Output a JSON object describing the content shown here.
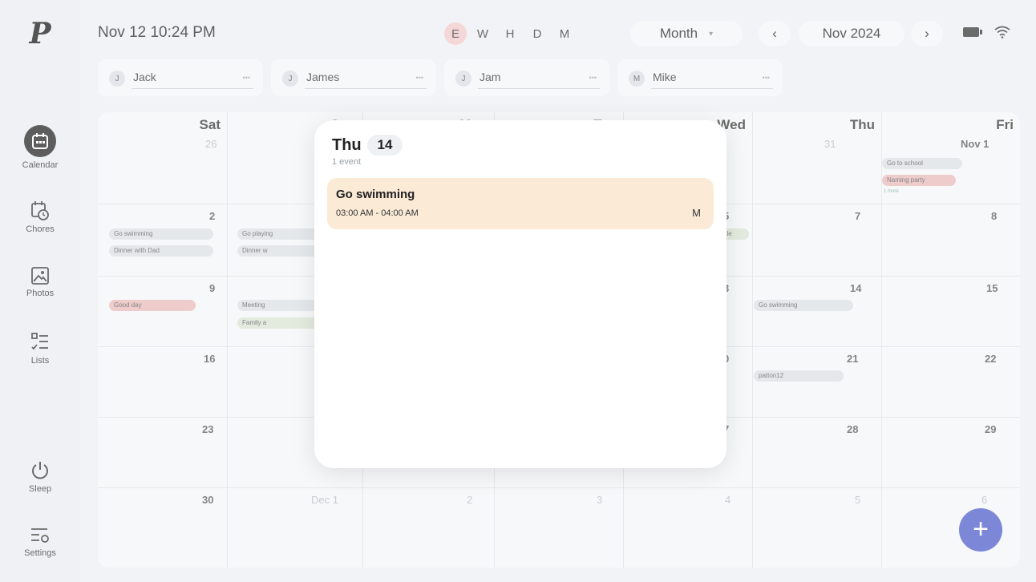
{
  "app": {
    "logo_letter": "P"
  },
  "sidebar": {
    "items": [
      {
        "label": "Calendar",
        "icon": "calendar-icon",
        "active": true
      },
      {
        "label": "Chores",
        "icon": "chores-icon"
      },
      {
        "label": "Photos",
        "icon": "photos-icon"
      },
      {
        "label": "Lists",
        "icon": "lists-icon"
      },
      {
        "label": "Sleep",
        "icon": "power-icon"
      },
      {
        "label": "Settings",
        "icon": "settings-icon"
      }
    ]
  },
  "header": {
    "datetime": "Nov 12 10:24 PM",
    "filters": [
      "E",
      "W",
      "H",
      "D",
      "M"
    ],
    "active_filter": "E",
    "view_select": "Month",
    "month_label": "Nov 2024",
    "prev": "‹",
    "next": "›"
  },
  "people": [
    {
      "initial": "J",
      "name": "Jack"
    },
    {
      "initial": "J",
      "name": "James"
    },
    {
      "initial": "J",
      "name": "Jam"
    },
    {
      "initial": "M",
      "name": "Mike"
    }
  ],
  "calendar": {
    "day_headers": [
      "Sat",
      "Sun",
      "Mon",
      "Tue",
      "Wed",
      "Thu",
      "Fri"
    ],
    "weeks": [
      [
        "26",
        "",
        "",
        "",
        "",
        "31",
        "Nov 1"
      ],
      [
        "2",
        "",
        "",
        "",
        "5",
        "7",
        "8"
      ],
      [
        "9",
        "",
        "",
        "",
        "3",
        "14",
        "15"
      ],
      [
        "16",
        "",
        "",
        "",
        "0",
        "21",
        "22"
      ],
      [
        "23",
        "",
        "",
        "",
        "7",
        "28",
        "29"
      ],
      [
        "30",
        "Dec 1",
        "2",
        "3",
        "4",
        "5",
        "6"
      ]
    ],
    "chips": {
      "fri_1a": "Go to school",
      "fri_1b": "Naming party",
      "fri_1c": "1 more",
      "sat_2a": "Go swimming",
      "sat_2b": "Dinner with Dad",
      "sun_2a": "Go playing",
      "sun_2b": "Dinner w",
      "wed_5": "sale",
      "sat_9": "Good day",
      "sun_9a": "Meeting",
      "sun_9b": "Family a",
      "thu_14": "Go swimming",
      "thu_21": "patton12"
    },
    "add_label": "+"
  },
  "modal": {
    "day_name": "Thu",
    "day_number": "14",
    "event_count": "1 event",
    "events": [
      {
        "title": "Go swimming",
        "time": "03:00 AM - 04:00 AM",
        "person": "M"
      }
    ]
  }
}
